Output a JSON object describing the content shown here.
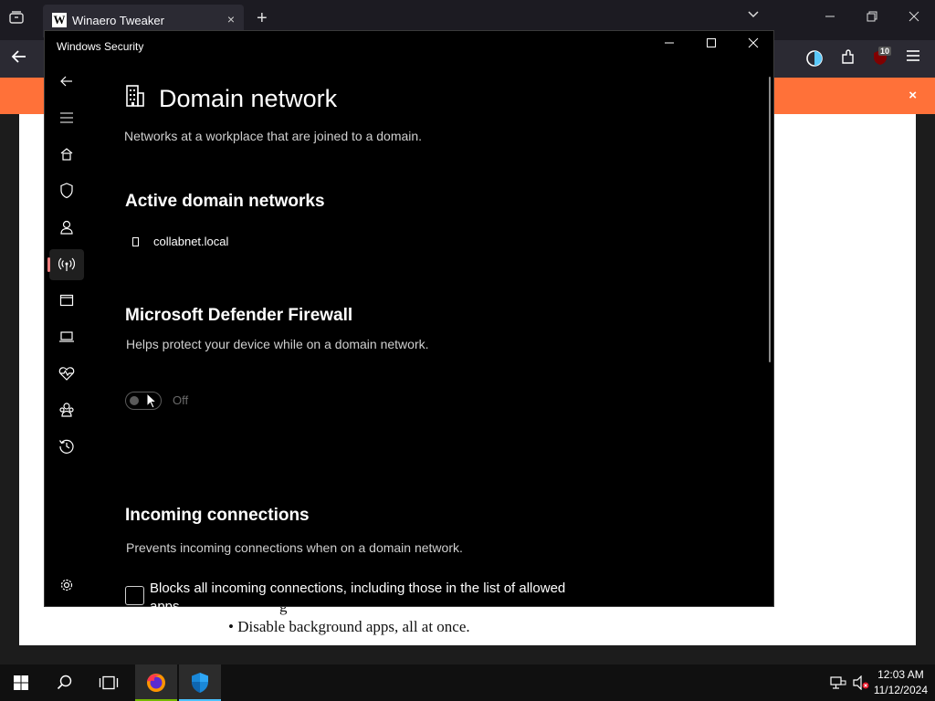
{
  "browser": {
    "tab_title": "Winaero Tweaker",
    "tab_favicon": "W",
    "new_tab_label": "+",
    "extension_badge": "10",
    "close_label": "×"
  },
  "page": {
    "bullet": "•",
    "bullet_text": "Disable background apps, all at once.",
    "partial_text": "g"
  },
  "window": {
    "title": "Windows Security"
  },
  "sidebar": {
    "items": [
      {
        "icon": "back-arrow-icon"
      },
      {
        "icon": "hamburger-icon"
      },
      {
        "icon": "home-icon"
      },
      {
        "icon": "shield-icon"
      },
      {
        "icon": "person-icon"
      },
      {
        "icon": "antenna-icon",
        "active": true
      },
      {
        "icon": "browser-window-icon"
      },
      {
        "icon": "laptop-icon"
      },
      {
        "icon": "heart-pulse-icon"
      },
      {
        "icon": "family-icon"
      },
      {
        "icon": "history-icon"
      },
      {
        "icon": "gear-icon"
      }
    ]
  },
  "main": {
    "title": "Domain network",
    "subtitle": "Networks at a workplace that are joined to a domain.",
    "active_heading": "Active domain networks",
    "network_name": "collabnet.local",
    "firewall_heading": "Microsoft Defender Firewall",
    "firewall_desc": "Helps protect your device while on a domain network.",
    "firewall_toggle_state": "Off",
    "incoming_heading": "Incoming connections",
    "incoming_desc": "Prevents incoming connections when on a domain network.",
    "block_label": "Blocks all incoming connections, including those in the list of allowed apps."
  },
  "taskbar": {
    "time": "12:03 AM",
    "date": "11/12/2024"
  },
  "colors": {
    "accent_orange": "#ff7139",
    "active_indicator": "#f08080",
    "taskbar_accent": "#4cc2ff"
  }
}
